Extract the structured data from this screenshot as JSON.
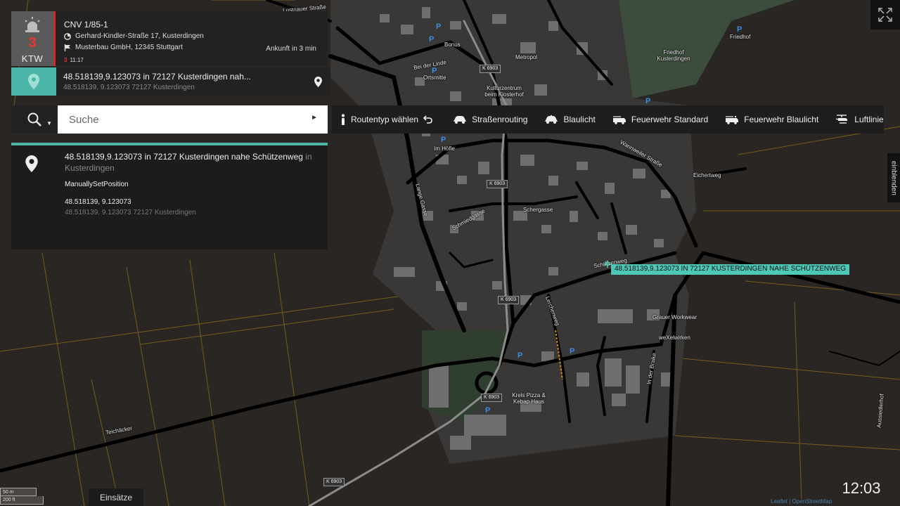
{
  "mission": {
    "code": "CNV 1/85-1",
    "count": "3",
    "unit": "KTW",
    "address": "Gerhard-Kindler-Straße 17, Kusterdingen",
    "destination": "Musterbau GmbH, 12345 Stuttgart",
    "arrival": "Ankunft in 3 min",
    "time_prefix": "3",
    "time": "11:17"
  },
  "location": {
    "title": "48.518139,9.123073 in 72127 Kusterdingen nah...",
    "sub": "48.518139, 9.123073  72127 Kusterdingen"
  },
  "search": {
    "placeholder": "Suche"
  },
  "result": {
    "title_main": "48.518139,9.123073 in 72127 Kusterdingen nahe Schützenweg",
    "title_in": "in",
    "title_place": "Kusterdingen",
    "type": "ManuallySetPosition",
    "coords": "48.518139, 9.123073",
    "coords_sub": "48.518139, 9.123073 72127 Kusterdingen"
  },
  "route_toolbar": {
    "choose_label": "Routentyp wählen",
    "options": [
      "Straßenrouting",
      "Blaulicht",
      "Feuerwehr Standard",
      "Feuerwehr Blaulicht",
      "Luftlinie"
    ]
  },
  "map": {
    "marker_label": "48.518139,9.123073 IN 72127 KUSTERDINGEN NAHE SCHÜTZENWEG",
    "labels": {
      "friedhof": "Friedhof",
      "friedhof_kusterdingen": "Friedhof Kusterdingen",
      "bonus": "Bonus",
      "metropol": "Metropol",
      "ortsmitte": "Ortsmitte",
      "kulturzentrum": "Kulturzentrum beim Klosterhof",
      "im_hoefle": "Im Höfle",
      "grauer_workwear": "Grauer Workwear",
      "wexelwirken": "weXelwirken",
      "krels_pizza": "Krels Pizza & Kebap Haus",
      "teichaecker": "Teichäcker",
      "eichertweg": "Eichertweg",
      "schuetzenweg": "Schützenweg",
      "wannweiler_strasse": "Wannweiler Straße",
      "lange_gasse": "Lange Gasse",
      "schmiedgasse": "Schmiedgasse",
      "schergasse": "Schergasse",
      "lerchenweg": "Lerchenweg",
      "in_der_braike": "In der Braike",
      "ausiedlerhof": "Aussiedlerhof",
      "lustnauer_strasse": "Lustnauer Straße",
      "bei_der_linde": "Bei der Linde"
    },
    "shields": [
      "K 6903",
      "K 6903",
      "K 6903",
      "K 6903",
      "K 6903"
    ]
  },
  "side_tab": "einblenden",
  "missions_tab": "Einsätze",
  "clock": "12:03",
  "scale": {
    "metric": "50 m",
    "imperial": "200 ft"
  },
  "attribution": "Leaflet | OpenStreetMap"
}
